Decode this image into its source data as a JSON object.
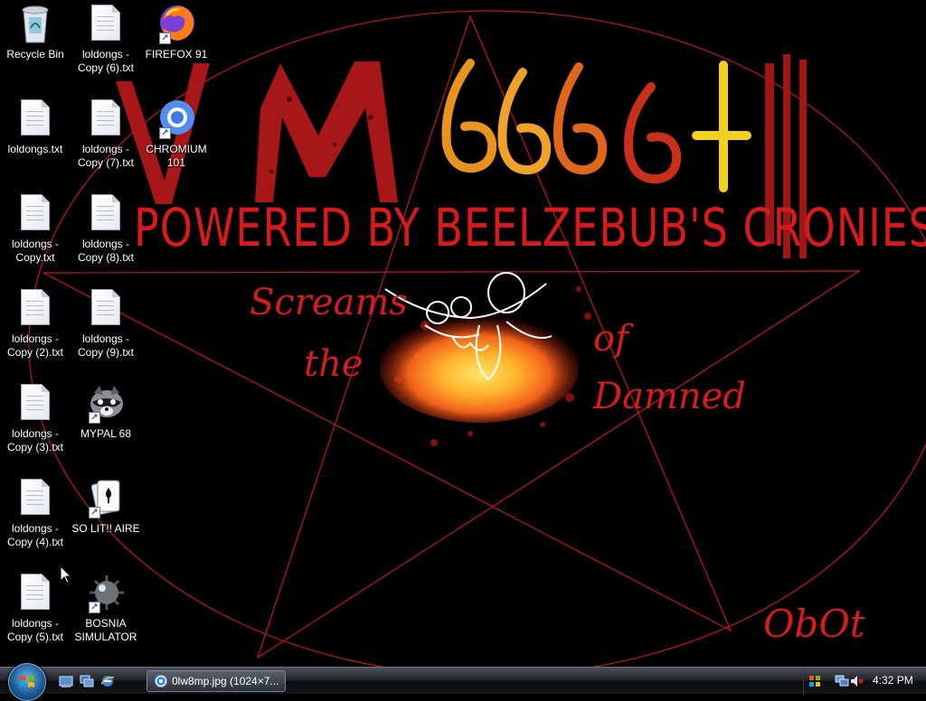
{
  "wallpaper": {
    "headline": "POWERED BY BEELZEBUB'S CRONIES",
    "logo": "VM6666+",
    "phrase": [
      "Screams",
      "the",
      "of",
      "Damned"
    ],
    "signature": "ObOt",
    "accent_color": "#e01818"
  },
  "desktop_icons": [
    {
      "label": "Recycle Bin",
      "icon": "recycle-bin-icon"
    },
    {
      "label": "loldongs - Copy (6).txt",
      "icon": "text-file-icon"
    },
    {
      "label": "FIREFOX 91",
      "icon": "firefox-icon"
    },
    {
      "label": "loldongs.txt",
      "icon": "text-file-icon"
    },
    {
      "label": "loldongs - Copy (7).txt",
      "icon": "text-file-icon"
    },
    {
      "label": "CHROMIUM 101",
      "icon": "chromium-icon"
    },
    {
      "label": "loldongs - Copy.txt",
      "icon": "text-file-icon"
    },
    {
      "label": "loldongs - Copy (8).txt",
      "icon": "text-file-icon"
    },
    {
      "label": "loldongs - Copy (2).txt",
      "icon": "text-file-icon"
    },
    {
      "label": "loldongs - Copy (9).txt",
      "icon": "text-file-icon"
    },
    {
      "label": "loldongs - Copy (3).txt",
      "icon": "text-file-icon"
    },
    {
      "label": "MYPAL 68",
      "icon": "mypal-raccoon-icon"
    },
    {
      "label": "loldongs - Copy (4).txt",
      "icon": "text-file-icon"
    },
    {
      "label": "SO LIT!! AIRE",
      "icon": "solitaire-cards-icon"
    },
    {
      "label": "loldongs - Copy (5).txt",
      "icon": "text-file-icon"
    },
    {
      "label": "BOSNIA SIMULATOR",
      "icon": "minesweeper-mine-icon"
    }
  ],
  "taskbar": {
    "start_button": "start-orb-icon",
    "quick_launch": [
      "show-desktop-icon",
      "switch-windows-icon",
      "internet-explorer-icon"
    ],
    "task_buttons": [
      {
        "label": "0lw8mp.jpg (1024×7...",
        "icon": "chromium-icon"
      }
    ],
    "tray_icons": [
      "windows-update-shield-icon",
      "network-icon",
      "volume-muted-icon"
    ],
    "clock": "4:32 PM"
  }
}
